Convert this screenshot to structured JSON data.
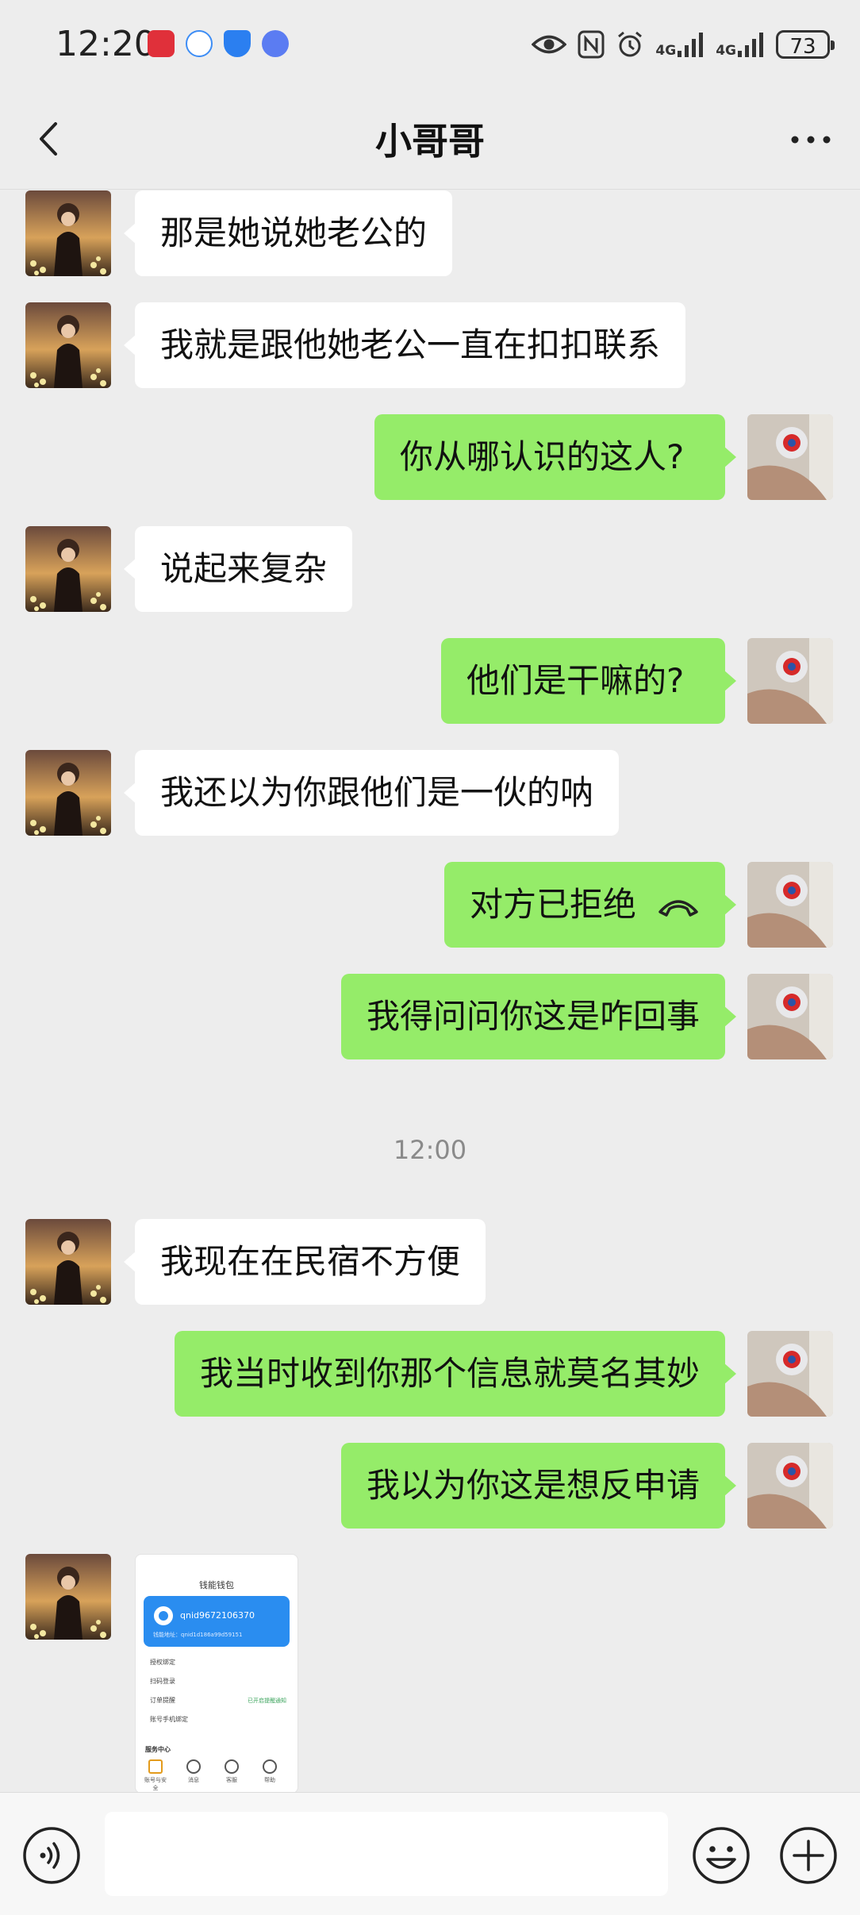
{
  "status_bar": {
    "time": "12:20",
    "net1": "4G",
    "net2": "4G",
    "battery": "73"
  },
  "header": {
    "title": "小哥哥"
  },
  "messages": [
    {
      "side": "in",
      "text": "那是她说她老公的"
    },
    {
      "side": "in",
      "text": "我就是跟他她老公一直在扣扣联系"
    },
    {
      "side": "out",
      "text": "你从哪认识的这人?"
    },
    {
      "side": "in",
      "text": "说起来复杂"
    },
    {
      "side": "out",
      "text": "他们是干嘛的?"
    },
    {
      "side": "in",
      "text": "我还以为你跟他们是一伙的呐"
    },
    {
      "side": "out",
      "text": "对方已拒绝",
      "icon": "phone-hangup-icon"
    },
    {
      "side": "out",
      "text": "我得问问你这是咋回事"
    },
    {
      "side": "in",
      "text": "我现在在民宿不方便"
    },
    {
      "side": "out",
      "text": "我当时收到你那个信息就莫名其妙"
    },
    {
      "side": "out",
      "text": "我以为你这是想反申请"
    }
  ],
  "timestamp": "12:00",
  "image_message": {
    "title": "钱能钱包",
    "account_id": "qnid9672106370",
    "account_sub": "钱能地址：qnid1d186a99d59151",
    "rows": [
      "授权绑定",
      "扫码登录",
      "订单提醒",
      "账号手机绑定"
    ],
    "row_note": "已开启提醒通知",
    "section": "服务中心",
    "icons": [
      "账号与安全",
      "消息",
      "客服",
      "帮助"
    ]
  },
  "input": {
    "placeholder": ""
  },
  "colors": {
    "background": "#ededed",
    "bubble_out": "#95ec69",
    "bubble_in": "#ffffff"
  }
}
